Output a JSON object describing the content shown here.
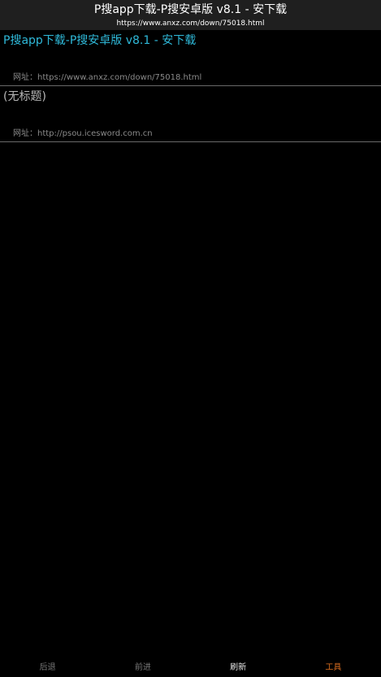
{
  "titlebar": {
    "title": "P搜app下载-P搜安卓版 v8.1 - 安下载",
    "url": "https://www.anxz.com/down/75018.html"
  },
  "history": {
    "url_label": "网址：",
    "items": [
      {
        "title": "P搜app下载-P搜安卓版 v8.1 - 安下载",
        "url": "https://www.anxz.com/down/75018.html"
      },
      {
        "title": "(无标题)",
        "url": "http://psou.icesword.com.cn"
      }
    ]
  },
  "bottom_bar": {
    "back": "后退",
    "forward": "前进",
    "refresh": "刷新",
    "tools": "工具"
  },
  "colors": {
    "visited_title": "#2fb9d9",
    "plain_title": "#b8b8b8",
    "tools_accent": "#e07020"
  }
}
